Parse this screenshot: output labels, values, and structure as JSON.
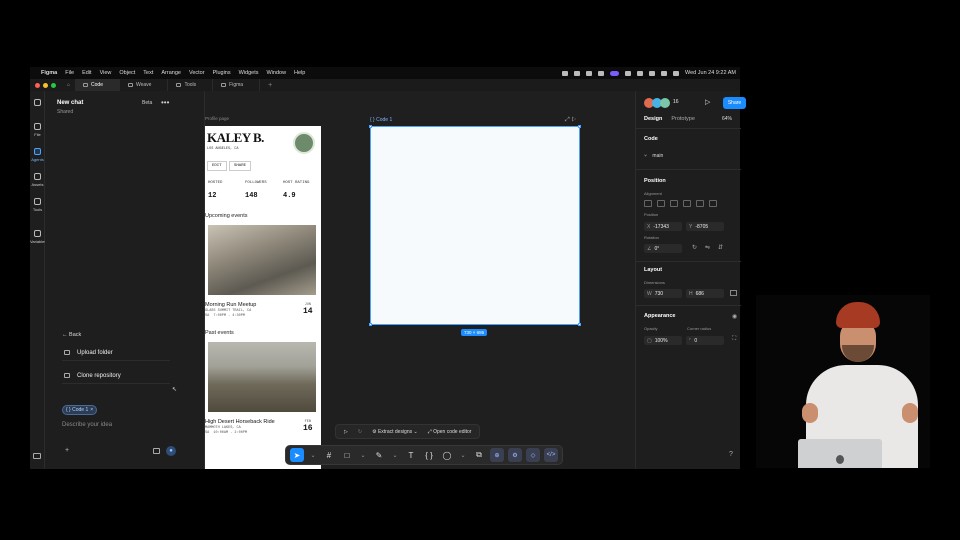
{
  "menubar": {
    "apple_glyph": "",
    "items": [
      "Figma",
      "File",
      "Edit",
      "View",
      "Object",
      "Text",
      "Arrange",
      "Vector",
      "Plugins",
      "Widgets",
      "Window",
      "Help"
    ],
    "clock": "Wed Jun 24  9:22 AM"
  },
  "tabs": {
    "items": [
      {
        "label": "Code",
        "active": true
      },
      {
        "label": "Weave",
        "active": false
      },
      {
        "label": "Tools",
        "active": false
      },
      {
        "label": "Figma",
        "active": false
      }
    ],
    "add": "+"
  },
  "rail": {
    "items": [
      {
        "label": "File"
      },
      {
        "label": "Agents"
      },
      {
        "label": "Assets"
      },
      {
        "label": "Tools"
      },
      {
        "label": "Variables"
      }
    ]
  },
  "chat": {
    "title": "New chat",
    "subtitle": "Shared",
    "badge": "Beta",
    "more": "•••",
    "back": "←  Back",
    "upload": "Upload folder",
    "clone": "Clone repository",
    "chip": "{ } Code 1",
    "chip_close": "×",
    "placeholder": "Describe your idea",
    "add": "+"
  },
  "canvas": {
    "profile_label": "Profile page",
    "profile": {
      "name": "KALEY B.",
      "location": "LOS ANGELES, CA",
      "btn_edit": "EDIT",
      "btn_share": "SHARE",
      "stats": [
        {
          "label": "HOSTED",
          "value": "12"
        },
        {
          "label": "FOLLOWERS",
          "value": "148"
        },
        {
          "label": "HOST RATING",
          "value": "4.9"
        }
      ],
      "upcoming_title": "Upcoming events",
      "event1": {
        "title": "Morning Run Meetup",
        "meta": "GLASS SUMMIT TRAIL, CA\nSA  7:00PM - 4:30PM",
        "month": "JUN",
        "day": "14"
      },
      "past_title": "Past events",
      "event2": {
        "title": "High Desert Horseback Ride",
        "meta": "MAMMOTH LAKES, CA\nSA  10:00AM - 2:00PM",
        "month": "FEB",
        "day": "16"
      }
    },
    "frame_label": "{ } Code 1",
    "frame_tools": "⤢  ▷",
    "dims": "730 × 686",
    "actions": {
      "play": "▷",
      "redo": "↻",
      "extract": "Extract designs",
      "extract_caret": "⌄",
      "open_editor": "Open code editor"
    },
    "toolbar": [
      "➤",
      "⌄",
      "#",
      "□",
      "⌄",
      "✎",
      "⌄",
      "T",
      "{ }",
      "◯",
      "⌄",
      "⧉",
      "⊕",
      "⚙",
      "◇",
      "</>"
    ]
  },
  "props": {
    "presence_count": "16",
    "play": "▷",
    "share": "Share",
    "tab_design": "Design",
    "tab_prototype": "Prototype",
    "zoom": "64%",
    "code_title": "Code",
    "branch": "main",
    "position_title": "Position",
    "alignment_label": "Alignment",
    "position_label": "Position",
    "x_key": "X",
    "x_val": "-17343",
    "y_key": "Y",
    "y_val": "-8705",
    "rotation_label": "Rotation",
    "rotation_val": "0°",
    "layout_title": "Layout",
    "dimensions_label": "Dimensions",
    "w_key": "W",
    "w_val": "730",
    "h_key": "H",
    "h_val": "686",
    "appearance_title": "Appearance",
    "opacity_label": "Opacity",
    "opacity_val": "100%",
    "radius_label": "Corner radius",
    "radius_val": "0",
    "help": "?"
  },
  "colors": {
    "accent": "#1a8cff",
    "traffic_red": "#ff5f57",
    "traffic_yellow": "#febc2e",
    "traffic_green": "#28c840"
  }
}
